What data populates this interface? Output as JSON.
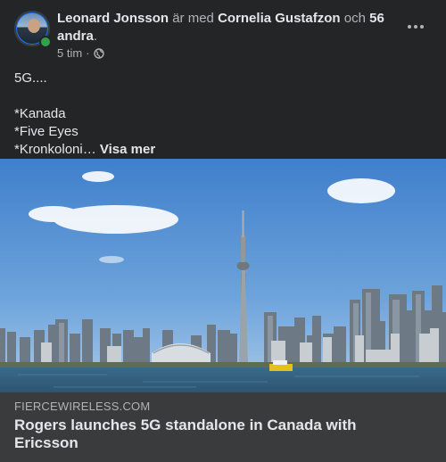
{
  "post": {
    "author": "Leonard Jonsson",
    "with_text": "är med",
    "tagged": "Cornelia Gustafzon",
    "and_text": "och",
    "others": "56 andra",
    "period": ".",
    "time": "5 tim",
    "dot": "·",
    "privacy_icon": "globe-icon",
    "lines": [
      "5G....",
      "*Kanada",
      "*Five Eyes",
      "*Kronkoloni…"
    ],
    "see_more": "Visa mer"
  },
  "link": {
    "domain": "FIERCEWIRELESS.COM",
    "title": "Rogers launches 5G standalone in Canada with Ericsson"
  },
  "colors": {
    "background": "#242526",
    "card": "#3a3b3c",
    "text_primary": "#e4e6eb",
    "text_secondary": "#b0b3b8",
    "online": "#31a24c"
  }
}
